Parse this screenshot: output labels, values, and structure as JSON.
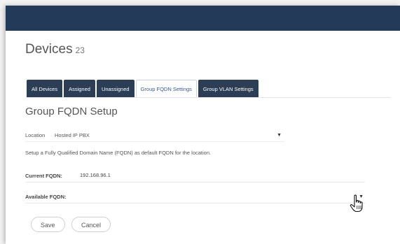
{
  "header": {
    "title": "Devices",
    "count": "23"
  },
  "tabs": [
    {
      "label": "All Devices"
    },
    {
      "label": "Assigned"
    },
    {
      "label": "Unassigned"
    },
    {
      "label": "Group FQDN Settings",
      "active": true
    },
    {
      "label": "Group VLAN Settings"
    }
  ],
  "section": {
    "title": "Group FQDN Setup"
  },
  "location": {
    "label": "Location",
    "value": "Hosted IP PBX"
  },
  "help_text": "Setup a Fully Qualified Domain Name (FQDN) as default FQDN for the location.",
  "current_fqdn": {
    "label": "Current FQDN:",
    "value": "192.168.96.1"
  },
  "available_fqdn": {
    "label": "Available FQDN:",
    "value": ""
  },
  "buttons": {
    "save": "Save",
    "cancel": "Cancel"
  },
  "colors": {
    "topbar": "#233a58",
    "tab_bg": "#2c3e55",
    "tab_active_text": "#3a5a85"
  }
}
